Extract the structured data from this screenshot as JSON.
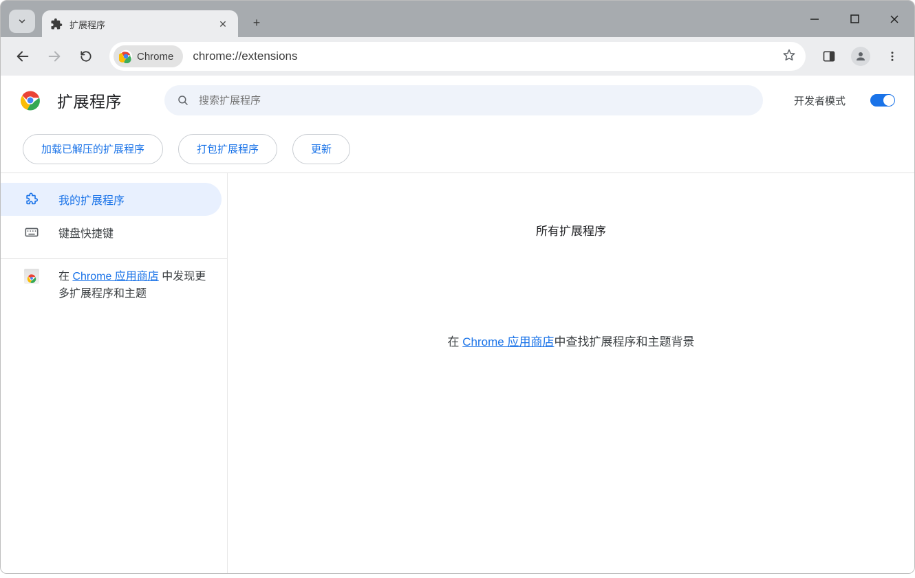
{
  "browser": {
    "tab_title": "扩展程序",
    "omnibox_chip": "Chrome",
    "url": "chrome://extensions"
  },
  "header": {
    "title": "扩展程序",
    "search_placeholder": "搜索扩展程序",
    "dev_mode_label": "开发者模式"
  },
  "actions": {
    "load_unpacked": "加载已解压的扩展程序",
    "pack": "打包扩展程序",
    "update": "更新"
  },
  "sidebar": {
    "my_extensions": "我的扩展程序",
    "keyboard_shortcuts": "键盘快捷键",
    "store_prefix": "在 ",
    "store_link": "Chrome 应用商店",
    "store_suffix": " 中发现更多扩展程序和主题"
  },
  "main": {
    "all_extensions": "所有扩展程序",
    "store_prefix": "在 ",
    "store_link": "Chrome 应用商店",
    "store_suffix": "中查找扩展程序和主题背景"
  }
}
